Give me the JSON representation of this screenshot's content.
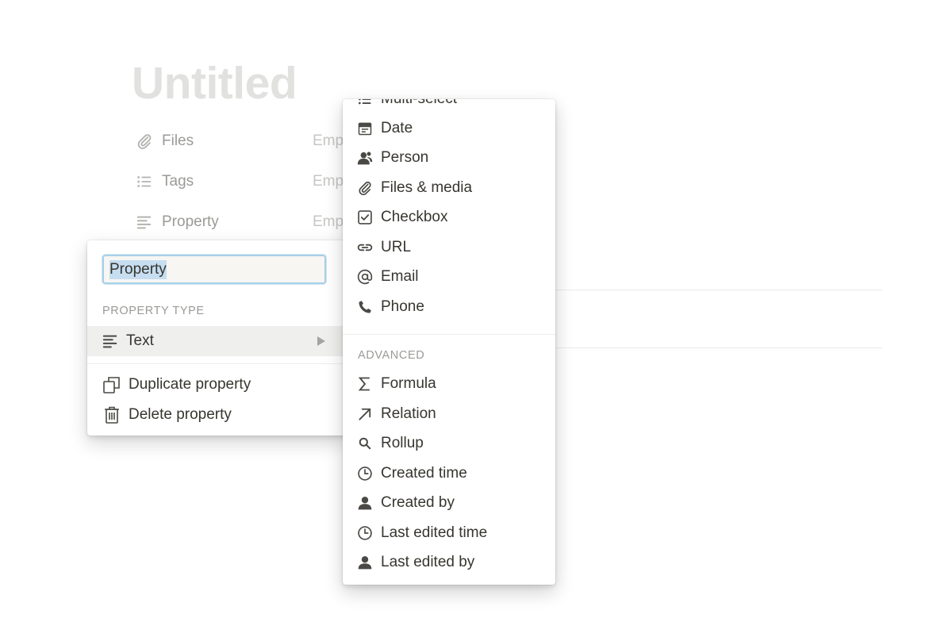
{
  "page": {
    "title": "Untitled"
  },
  "properties": [
    {
      "icon": "paperclip-icon",
      "name": "Files",
      "value": "Emp"
    },
    {
      "icon": "list-icon",
      "name": "Tags",
      "value": "Emp"
    },
    {
      "icon": "text-lines-icon",
      "name": "Property",
      "value": "Emp"
    }
  ],
  "property_menu": {
    "name_value": "Property",
    "type_section_label": "PROPERTY TYPE",
    "selected_type": {
      "icon": "text-lines-icon",
      "label": "Text"
    },
    "actions": [
      {
        "icon": "duplicate-icon",
        "label": "Duplicate property"
      },
      {
        "icon": "trash-icon",
        "label": "Delete property"
      }
    ]
  },
  "type_menu": {
    "basic_items": [
      {
        "icon": "list-icon",
        "label": "Multi-select"
      },
      {
        "icon": "calendar-icon",
        "label": "Date"
      },
      {
        "icon": "person-icon",
        "label": "Person"
      },
      {
        "icon": "paperclip-icon",
        "label": "Files & media"
      },
      {
        "icon": "checkbox-icon",
        "label": "Checkbox"
      },
      {
        "icon": "link-icon",
        "label": "URL"
      },
      {
        "icon": "at-icon",
        "label": "Email"
      },
      {
        "icon": "phone-icon",
        "label": "Phone"
      }
    ],
    "advanced_label": "ADVANCED",
    "advanced_items": [
      {
        "icon": "sigma-icon",
        "label": "Formula"
      },
      {
        "icon": "arrow-up-right-icon",
        "label": "Relation"
      },
      {
        "icon": "search-icon",
        "label": "Rollup"
      },
      {
        "icon": "clock-icon",
        "label": "Created time"
      },
      {
        "icon": "user-icon",
        "label": "Created by"
      },
      {
        "icon": "clock-icon",
        "label": "Last edited time"
      },
      {
        "icon": "user-icon",
        "label": "Last edited by"
      }
    ]
  },
  "colors": {
    "text": "#37352f",
    "muted": "#9b9a97",
    "title_placeholder": "#e1e1df",
    "selected_row": "#efefee",
    "input_focus": "#a8d0e8",
    "icon": "#4a4945"
  }
}
